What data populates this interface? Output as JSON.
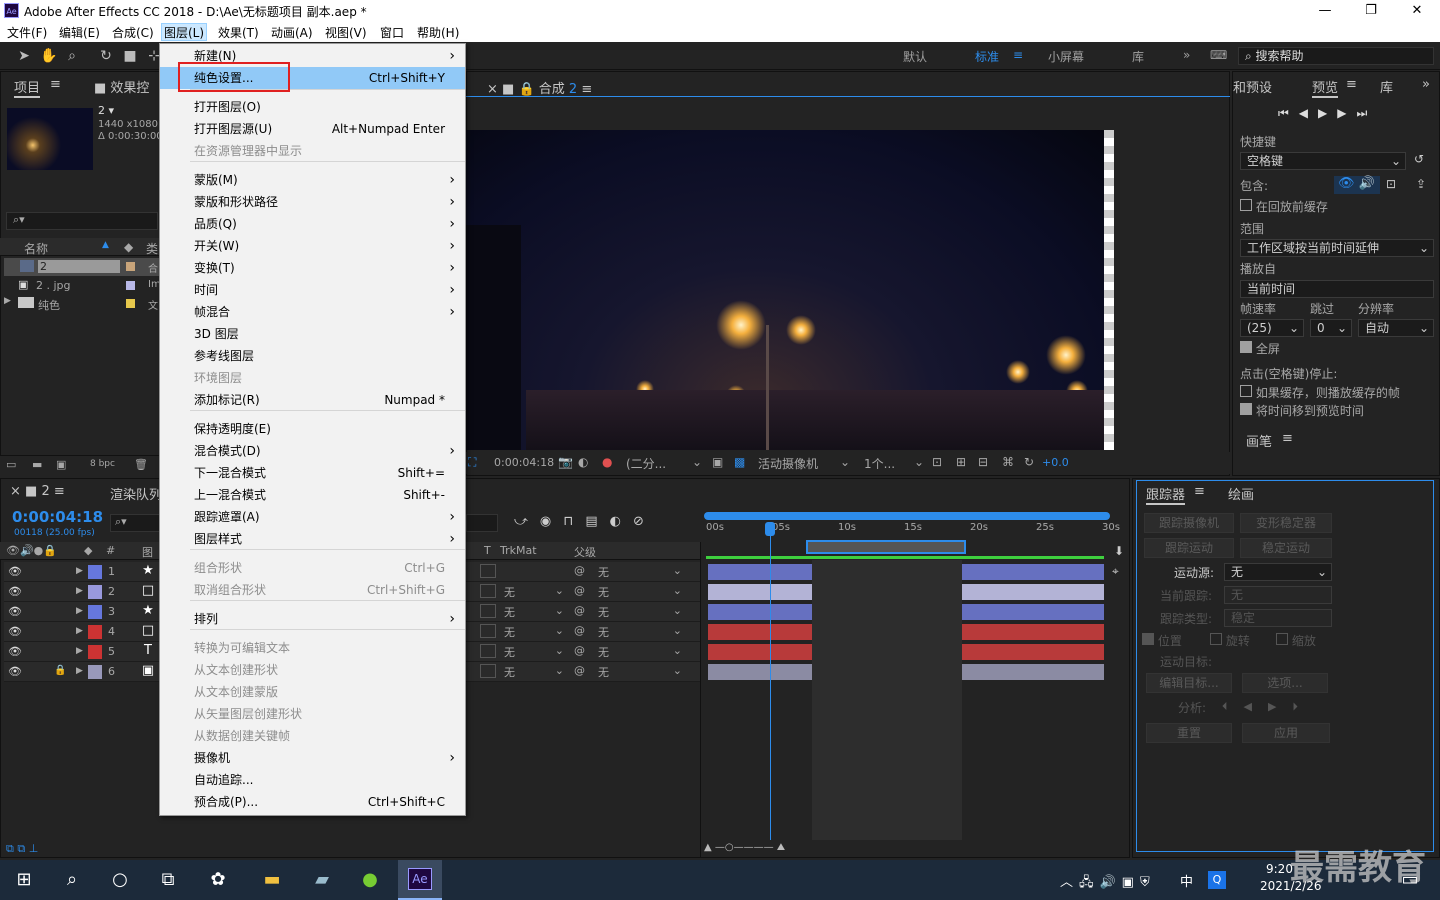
{
  "title_bar": {
    "app_logo": "Ae",
    "title": "Adobe After Effects CC 2018 - D:\\Ae\\无标题项目 副本.aep *"
  },
  "menubar": [
    "文件(F)",
    "编辑(E)",
    "合成(C)",
    "图层(L)",
    "效果(T)",
    "动画(A)",
    "视图(V)",
    "窗口",
    "帮助(H)"
  ],
  "workspaces": [
    "默认",
    "标准",
    "小屏幕",
    "库"
  ],
  "search_help": "搜索帮助",
  "project": {
    "tab": "项目",
    "effects_tab": "效果控",
    "item_name": "2",
    "item_size": "1440 x1080 (",
    "item_dur": "Δ 0:00:30:00",
    "col_name": "名称",
    "col_type": "类",
    "rows": [
      {
        "name": "2",
        "type": "合"
      },
      {
        "name": "2 . jpg",
        "type": "Im"
      },
      {
        "name": "纯色",
        "type": "文"
      }
    ],
    "bpc": "8 bpc"
  },
  "comp": {
    "tab": "合成",
    "tab_num": "2",
    "timecode": "0:00:04:18",
    "resolution": "(二分...",
    "camera": "活动摄像机",
    "views": "1个...",
    "exposure": "+0.0"
  },
  "timeline": {
    "comp_tab": "2",
    "render_tab": "渲染队列",
    "timecode": "0:00:04:18",
    "frames": "00118 (25.00 fps)",
    "col_trkmat": "TrkMat",
    "col_parent": "父级",
    "col_hash": "#",
    "col_source": "图",
    "layers": [
      {
        "num": "1",
        "color": "#6677dd",
        "icon": "★",
        "trk": "",
        "parent": "无"
      },
      {
        "num": "2",
        "color": "#9999dd",
        "icon": "□",
        "trk": "无",
        "parent": "无"
      },
      {
        "num": "3",
        "color": "#6677dd",
        "icon": "★",
        "trk": "无",
        "parent": "无"
      },
      {
        "num": "4",
        "color": "#cc3333",
        "icon": "□",
        "trk": "无",
        "parent": "无"
      },
      {
        "num": "5",
        "color": "#cc3333",
        "icon": "T",
        "trk": "无",
        "parent": "无"
      },
      {
        "num": "6",
        "color": "#9999bb",
        "icon": "▣",
        "trk": "无",
        "parent": "无"
      }
    ],
    "ruler": [
      "00s",
      "05s",
      "10s",
      "15s",
      "20s",
      "25s",
      "30s"
    ],
    "bar_colors": [
      "#6670c0",
      "#b3b3d6",
      "#6670c0",
      "#b83a3a",
      "#b83a3a",
      "#8b8ba3"
    ]
  },
  "menu": {
    "items": [
      {
        "label": "新建(N)",
        "shortcut": "",
        "arrow": true,
        "disabled": false
      },
      {
        "label": "纯色设置...",
        "shortcut": "Ctrl+Shift+Y",
        "arrow": false,
        "disabled": false,
        "highlight": true
      },
      {
        "label": "打开图层(O)",
        "shortcut": "",
        "arrow": false,
        "disabled": false
      },
      {
        "label": "打开图层源(U)",
        "shortcut": "Alt+Numpad Enter",
        "arrow": false,
        "disabled": false
      },
      {
        "label": "在资源管理器中显示",
        "shortcut": "",
        "arrow": false,
        "disabled": true
      },
      {
        "label": "蒙版(M)",
        "shortcut": "",
        "arrow": true,
        "disabled": false
      },
      {
        "label": "蒙版和形状路径",
        "shortcut": "",
        "arrow": true,
        "disabled": false
      },
      {
        "label": "品质(Q)",
        "shortcut": "",
        "arrow": true,
        "disabled": false
      },
      {
        "label": "开关(W)",
        "shortcut": "",
        "arrow": true,
        "disabled": false
      },
      {
        "label": "变换(T)",
        "shortcut": "",
        "arrow": true,
        "disabled": false
      },
      {
        "label": "时间",
        "shortcut": "",
        "arrow": true,
        "disabled": false
      },
      {
        "label": "帧混合",
        "shortcut": "",
        "arrow": true,
        "disabled": false
      },
      {
        "label": "3D 图层",
        "shortcut": "",
        "arrow": false,
        "disabled": false
      },
      {
        "label": "参考线图层",
        "shortcut": "",
        "arrow": false,
        "disabled": false
      },
      {
        "label": "环境图层",
        "shortcut": "",
        "arrow": false,
        "disabled": true
      },
      {
        "label": "添加标记(R)",
        "shortcut": "Numpad *",
        "arrow": false,
        "disabled": false
      },
      {
        "label": "保持透明度(E)",
        "shortcut": "",
        "arrow": false,
        "disabled": false
      },
      {
        "label": "混合模式(D)",
        "shortcut": "",
        "arrow": true,
        "disabled": false
      },
      {
        "label": "下一混合模式",
        "shortcut": "Shift+=",
        "arrow": false,
        "disabled": false
      },
      {
        "label": "上一混合模式",
        "shortcut": "Shift+-",
        "arrow": false,
        "disabled": false
      },
      {
        "label": "跟踪遮罩(A)",
        "shortcut": "",
        "arrow": true,
        "disabled": false
      },
      {
        "label": "图层样式",
        "shortcut": "",
        "arrow": true,
        "disabled": false
      },
      {
        "label": "组合形状",
        "shortcut": "Ctrl+G",
        "arrow": false,
        "disabled": true
      },
      {
        "label": "取消组合形状",
        "shortcut": "Ctrl+Shift+G",
        "arrow": false,
        "disabled": true
      },
      {
        "label": "排列",
        "shortcut": "",
        "arrow": true,
        "disabled": false
      },
      {
        "label": "转换为可编辑文本",
        "shortcut": "",
        "arrow": false,
        "disabled": true
      },
      {
        "label": "从文本创建形状",
        "shortcut": "",
        "arrow": false,
        "disabled": true
      },
      {
        "label": "从文本创建蒙版",
        "shortcut": "",
        "arrow": false,
        "disabled": true
      },
      {
        "label": "从矢量图层创建形状",
        "shortcut": "",
        "arrow": false,
        "disabled": true
      },
      {
        "label": "从数据创建关键帧",
        "shortcut": "",
        "arrow": false,
        "disabled": true
      },
      {
        "label": "摄像机",
        "shortcut": "",
        "arrow": true,
        "disabled": false
      },
      {
        "label": "自动追踪...",
        "shortcut": "",
        "arrow": false,
        "disabled": false
      },
      {
        "label": "预合成(P)...",
        "shortcut": "Ctrl+Shift+C",
        "arrow": false,
        "disabled": false
      }
    ]
  },
  "preview": {
    "tab_presets": "和预设",
    "tab": "预览",
    "lib": "库",
    "shortcut_label": "快捷键",
    "shortcut_value": "空格键",
    "include_label": "包含:",
    "cache_before": "在回放前缓存",
    "range_label": "范围",
    "range_value": "工作区域按当前时间延伸",
    "play_from_label": "播放自",
    "play_from_value": "当前时间",
    "fps_label": "帧速率",
    "skip_label": "跳过",
    "res_label": "分辨率",
    "fps_value": "(25)",
    "skip_value": "0",
    "res_value": "自动",
    "fullscreen": "全屏",
    "stop_label": "点击(空格键)停止:",
    "opt1": "如果缓存，则播放缓存的帧",
    "opt2": "将时间移到预览时间",
    "brush_tab": "画笔"
  },
  "tracker": {
    "tab": "跟踪器",
    "paint_tab": "绘画",
    "btn_track_camera": "跟踪摄像机",
    "btn_warp": "变形稳定器",
    "btn_track_motion": "跟踪运动",
    "btn_stabilize": "稳定运动",
    "source_label": "运动源:",
    "source_value": "无",
    "current_label": "当前跟踪:",
    "current_value": "无",
    "type_label": "跟踪类型:",
    "type_value": "稳定",
    "pos": "位置",
    "rot": "旋转",
    "scale": "缩放",
    "target_label": "运动目标:",
    "edit_target": "编辑目标...",
    "options": "选项...",
    "analyze": "分析:",
    "reset": "重置",
    "apply": "应用"
  },
  "taskbar": {
    "time": "9:20",
    "date": "2021/2/26",
    "ime": "中",
    "watermark": "最需教育",
    "ae_label": "Ae"
  }
}
